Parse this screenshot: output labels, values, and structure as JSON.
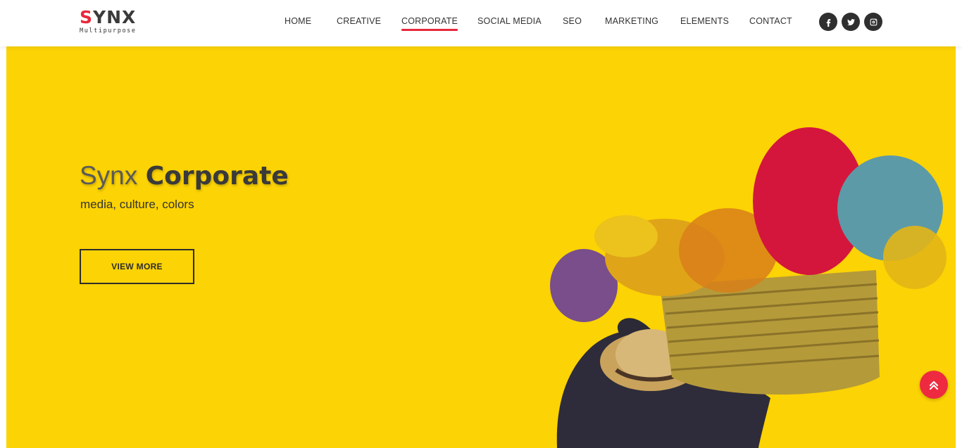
{
  "logo": {
    "main_accent": "S",
    "main_rest": "YNX",
    "sub": "Multipurpose"
  },
  "nav": {
    "items": [
      {
        "label": "HOME"
      },
      {
        "label": "CREATIVE"
      },
      {
        "label": "CORPORATE",
        "active": true
      },
      {
        "label": "SOCIAL MEDIA"
      },
      {
        "label": "SEO"
      },
      {
        "label": "MARKETING"
      },
      {
        "label": "ELEMENTS"
      },
      {
        "label": "CONTACT"
      }
    ]
  },
  "social": [
    {
      "icon": "facebook-icon"
    },
    {
      "icon": "twitter-icon"
    },
    {
      "icon": "instagram-icon"
    }
  ],
  "hero": {
    "title_light": "Synx",
    "title_bold": "Corporate",
    "subtitle": "media, culture, colors",
    "button_label": "VIEW MORE",
    "background_color": "#fcd304"
  },
  "scroll_top": {
    "icon": "double-chevron-up-icon"
  },
  "colors": {
    "accent": "#e8283c",
    "dark": "#2f2f2f"
  }
}
